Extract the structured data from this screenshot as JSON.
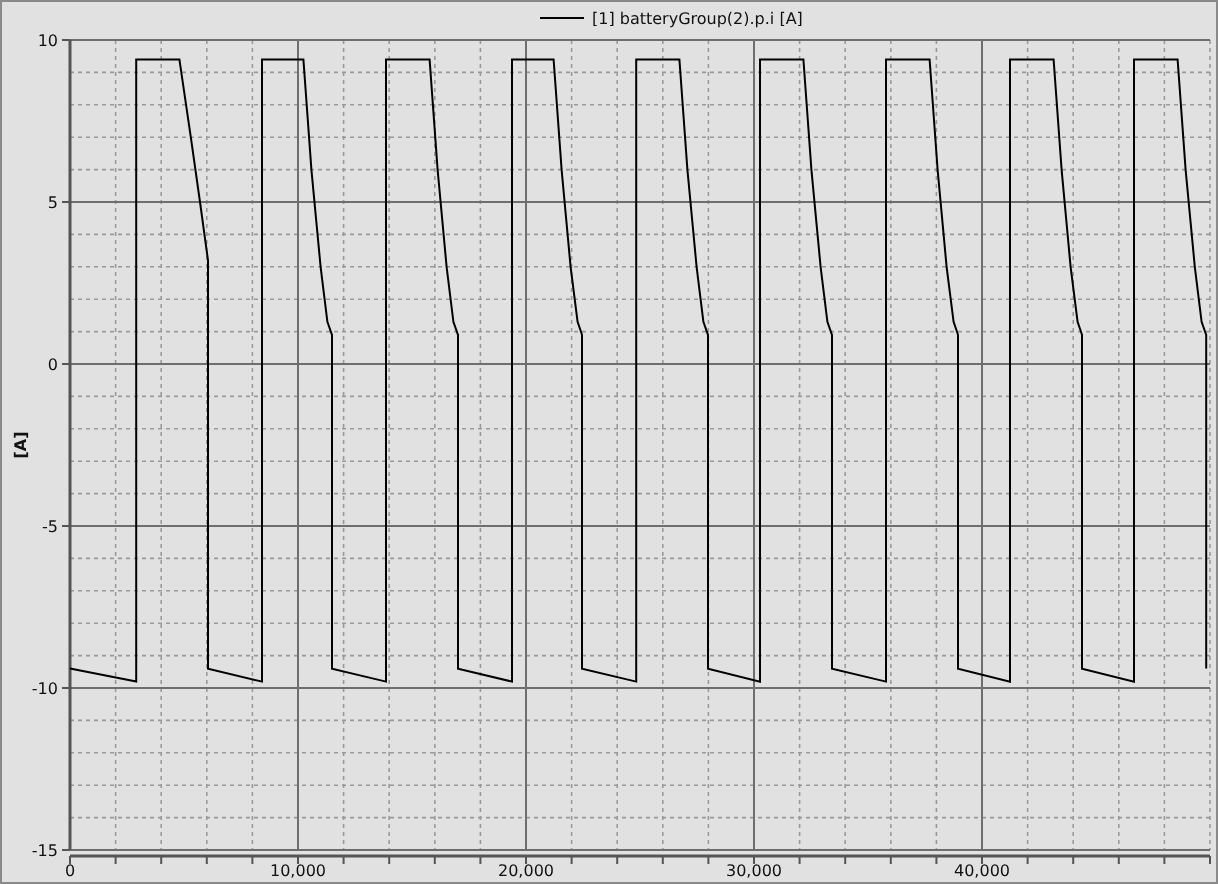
{
  "chart": {
    "chart_data": {
      "type": "line",
      "grid": true,
      "ylabel": "[A]",
      "xlim": [
        0,
        50000
      ],
      "ylim": [
        -15,
        10
      ],
      "xticks": [
        {
          "value": 0,
          "label": "0"
        },
        {
          "value": 10000,
          "label": "10,000"
        },
        {
          "value": 20000,
          "label": "20,000"
        },
        {
          "value": 30000,
          "label": "30,000"
        },
        {
          "value": 40000,
          "label": "40,000"
        }
      ],
      "yticks": [
        -15,
        -10,
        -5,
        0,
        5,
        10
      ],
      "x": [
        0,
        2900,
        2900,
        4800,
        5300,
        5700,
        6050,
        6050,
        8420,
        8420,
        10240,
        10590,
        10990,
        11290,
        11490,
        11490,
        13860,
        13860,
        15770,
        16120,
        16520,
        16820,
        17020,
        17020,
        19390,
        19390,
        21210,
        21560,
        21960,
        22260,
        22460,
        22460,
        24830,
        24830,
        26730,
        27080,
        27480,
        27780,
        27980,
        27980,
        30260,
        30260,
        32170,
        32520,
        32920,
        33220,
        33420,
        33420,
        35790,
        35790,
        37700,
        38050,
        38450,
        38750,
        38950,
        38950,
        41230,
        41230,
        43140,
        43490,
        43890,
        44190,
        44390,
        44390,
        46670,
        46670,
        48580,
        48930,
        49330,
        49630,
        49830,
        49830
      ],
      "series": [
        {
          "name": "[1] batteryGroup(2).p.i [A]",
          "color": "#000000",
          "values": [
            -9.4,
            -9.8,
            9.4,
            9.4,
            7,
            5,
            3.2,
            -9.4,
            -9.8,
            9.4,
            9.4,
            6,
            3,
            1.3,
            0.9,
            -9.4,
            -9.8,
            9.4,
            9.4,
            6,
            3,
            1.3,
            0.9,
            -9.4,
            -9.8,
            9.4,
            9.4,
            6,
            3,
            1.3,
            0.9,
            -9.4,
            -9.8,
            9.4,
            9.4,
            6,
            3,
            1.3,
            0.9,
            -9.4,
            -9.8,
            9.4,
            9.4,
            6,
            3,
            1.3,
            0.9,
            -9.4,
            -9.8,
            9.4,
            9.4,
            6,
            3,
            1.3,
            0.9,
            -9.4,
            -9.8,
            9.4,
            9.4,
            6,
            3,
            1.3,
            0.9,
            -9.4,
            -9.8,
            9.4,
            9.4,
            6,
            3,
            1.3,
            0.9,
            -9.4
          ]
        }
      ]
    }
  }
}
